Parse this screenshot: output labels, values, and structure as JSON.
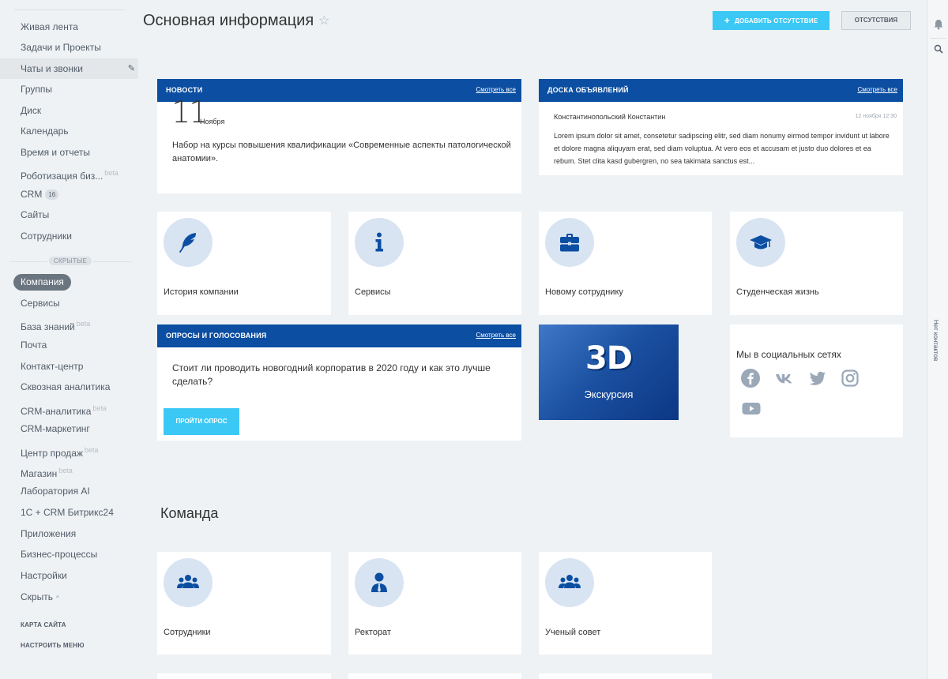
{
  "sidebar": {
    "items": [
      {
        "label": "Живая лента"
      },
      {
        "label": "Задачи и Проекты"
      },
      {
        "label": "Чаты и звонки"
      },
      {
        "label": "Группы"
      },
      {
        "label": "Диск"
      },
      {
        "label": "Календарь"
      },
      {
        "label": "Время и отчеты"
      },
      {
        "label": "Роботизация биз...",
        "beta": "beta"
      },
      {
        "label": "CRM",
        "count": "16"
      },
      {
        "label": "Сайты"
      },
      {
        "label": "Сотрудники"
      }
    ],
    "hidden_label": "СКРЫТЫЕ",
    "active_pill": "Компания",
    "hidden_items": [
      {
        "label": "Сервисы"
      },
      {
        "label": "База знаний",
        "beta": "beta"
      },
      {
        "label": "Почта"
      },
      {
        "label": "Контакт-центр"
      },
      {
        "label": "Сквозная аналитика"
      },
      {
        "label": "CRM-аналитика",
        "beta": "beta"
      },
      {
        "label": "CRM-маркетинг"
      },
      {
        "label": "Центр продаж",
        "beta": "beta"
      },
      {
        "label": "Магазин",
        "beta": "beta"
      },
      {
        "label": "Лаборатория AI"
      },
      {
        "label": "1С + CRM Битрикс24"
      },
      {
        "label": "Приложения"
      },
      {
        "label": "Бизнес-процессы"
      },
      {
        "label": "Настройки"
      },
      {
        "label": "Скрыть"
      }
    ],
    "sitemap": "КАРТА САЙТА",
    "configure_menu": "НАСТРОИТЬ МЕНЮ"
  },
  "header": {
    "title": "Основная информация",
    "add_absence": "ДОБАВИТЬ ОТСУТСТВИЕ",
    "absences": "ОТСУТСТВИЯ"
  },
  "right_panel": {
    "no_contacts": "Нет контактов"
  },
  "news": {
    "title": "НОВОСТИ",
    "see_all": "Смотреть все",
    "day": "11",
    "month": "Ноября",
    "text": "Набор на курсы повышения квалификации «Современные аспекты патологической анатомии»."
  },
  "announcements": {
    "title": "ДОСКА ОБЪЯВЛЕНИЙ",
    "see_all": "Смотреть все",
    "author": "Константинопольский Константин",
    "date": "12 ноября 12:30",
    "text": "Lorem ipsum dolor sit amet, consetetur sadipscing elitr, sed diam nonumy eirmod tempor invidunt ut labore et dolore magna aliquyam erat, sed diam voluptua. At vero eos et accusam et justo duo dolores et ea rebum. Stet clita kasd gubergren, no sea takimata sanctus est..."
  },
  "tiles": [
    {
      "label": "История компании",
      "icon": "feather-icon"
    },
    {
      "label": "Сервисы",
      "icon": "info-icon"
    },
    {
      "label": "Новому сотруднику",
      "icon": "briefcase-icon"
    },
    {
      "label": "Студенческая жизнь",
      "icon": "graduation-cap-icon"
    }
  ],
  "polls": {
    "title": "ОПРОСЫ И ГОЛОСОВАНИЯ",
    "see_all": "Смотреть все",
    "question": "Стоит ли проводить новогодний корпоратив в 2020 году и как это лучше сделать?",
    "button": "ПРОЙТИ ОПРОС"
  },
  "tour": {
    "big": "3D",
    "sub": "Экскурсия"
  },
  "social": {
    "title": "Мы в социальных сетях",
    "icons": [
      "facebook-icon",
      "vk-icon",
      "twitter-icon",
      "instagram-icon",
      "youtube-icon"
    ]
  },
  "team": {
    "title": "Команда",
    "tiles": [
      {
        "label": "Сотрудники",
        "icon": "group-icon"
      },
      {
        "label": "Ректорат",
        "icon": "person-tie-icon"
      },
      {
        "label": "Ученый совет",
        "icon": "group-icon"
      }
    ]
  },
  "colors": {
    "brand_blue": "#0b4ea2",
    "accent_cyan": "#3bc8f5",
    "icon_circle": "#d8e4f2",
    "background": "#eef2f4"
  }
}
